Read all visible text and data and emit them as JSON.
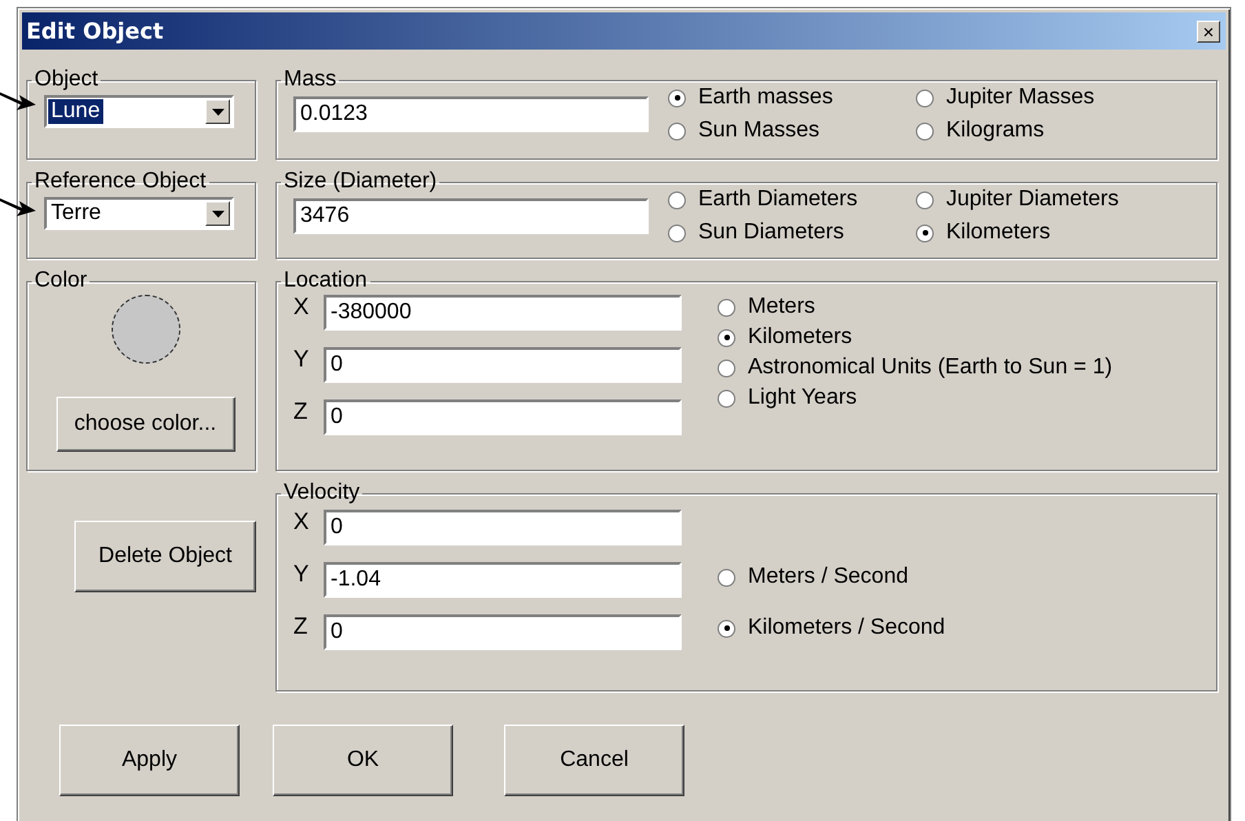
{
  "window": {
    "title": "Edit Object",
    "close": "×"
  },
  "object": {
    "label": "Object",
    "value": "Lune",
    "focused": true
  },
  "reference": {
    "label": "Reference Object",
    "value": "Terre",
    "focused": false
  },
  "mass": {
    "label": "Mass",
    "value": "0.0123",
    "units": [
      {
        "label": "Earth masses",
        "selected": true
      },
      {
        "label": "Jupiter Masses",
        "selected": false
      },
      {
        "label": "Sun Masses",
        "selected": false
      },
      {
        "label": "Kilograms",
        "selected": false
      }
    ]
  },
  "size": {
    "label": "Size (Diameter)",
    "value": "3476",
    "units": [
      {
        "label": "Earth Diameters",
        "selected": false
      },
      {
        "label": "Jupiter Diameters",
        "selected": false
      },
      {
        "label": "Sun Diameters",
        "selected": false
      },
      {
        "label": "Kilometers",
        "selected": true
      }
    ]
  },
  "color": {
    "label": "Color",
    "color": "#c6c6c6",
    "button": "choose color..."
  },
  "location": {
    "label": "Location",
    "fields": [
      {
        "axis": "X",
        "value": "-380000"
      },
      {
        "axis": "Y",
        "value": "0"
      },
      {
        "axis": "Z",
        "value": "0"
      }
    ],
    "units": [
      {
        "label": "Meters",
        "selected": false
      },
      {
        "label": "Kilometers",
        "selected": true
      },
      {
        "label": "Astronomical Units (Earth to Sun = 1)",
        "selected": false
      },
      {
        "label": "Light Years",
        "selected": false
      }
    ]
  },
  "delete_button": "Delete Object",
  "velocity": {
    "label": "Velocity",
    "fields": [
      {
        "axis": "X",
        "value": "0"
      },
      {
        "axis": "Y",
        "value": "-1.04"
      },
      {
        "axis": "Z",
        "value": "0"
      }
    ],
    "units": [
      {
        "label": "Meters / Second",
        "selected": false
      },
      {
        "label": "Kilometers / Second",
        "selected": true
      }
    ]
  },
  "buttons": [
    "Apply",
    "OK",
    "Cancel"
  ]
}
